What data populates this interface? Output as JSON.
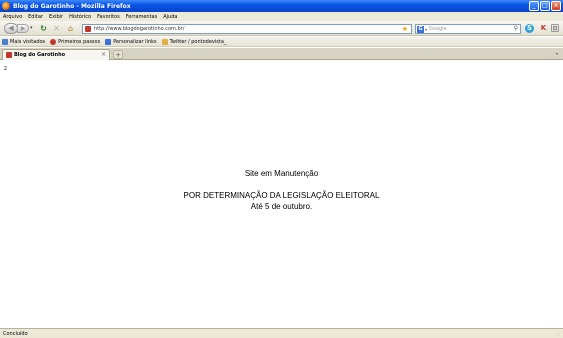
{
  "window": {
    "title": "Blog do Garotinho - Mozilla Firefox"
  },
  "menu": [
    "Arquivo",
    "Editar",
    "Exibir",
    "Histórico",
    "Favoritos",
    "Ferramentas",
    "Ajuda"
  ],
  "navbar": {
    "url": "http://www.blogdogarotinho.com.br/",
    "search_placeholder": "Google",
    "search_engine_letter": "G"
  },
  "bookmarks": [
    {
      "label": "Mais visitados",
      "color": "#4a7fd4"
    },
    {
      "label": "Primeiros passos",
      "color": "#c0392b"
    },
    {
      "label": "Personalizar links",
      "color": "#3a72d8"
    },
    {
      "label": "Twitter / pontodevista_",
      "color": "#e0b040"
    }
  ],
  "tabs": [
    {
      "label": "Blog do Garotinho"
    }
  ],
  "content": {
    "corner_mark": "z",
    "line1": "Site em Manutenção",
    "line2": "POR DETERMINAÇÃO DA LEGISLAÇÃO ELEITORAL",
    "line3": "Até 5 de outubro."
  },
  "status": {
    "text": "Concluído"
  }
}
